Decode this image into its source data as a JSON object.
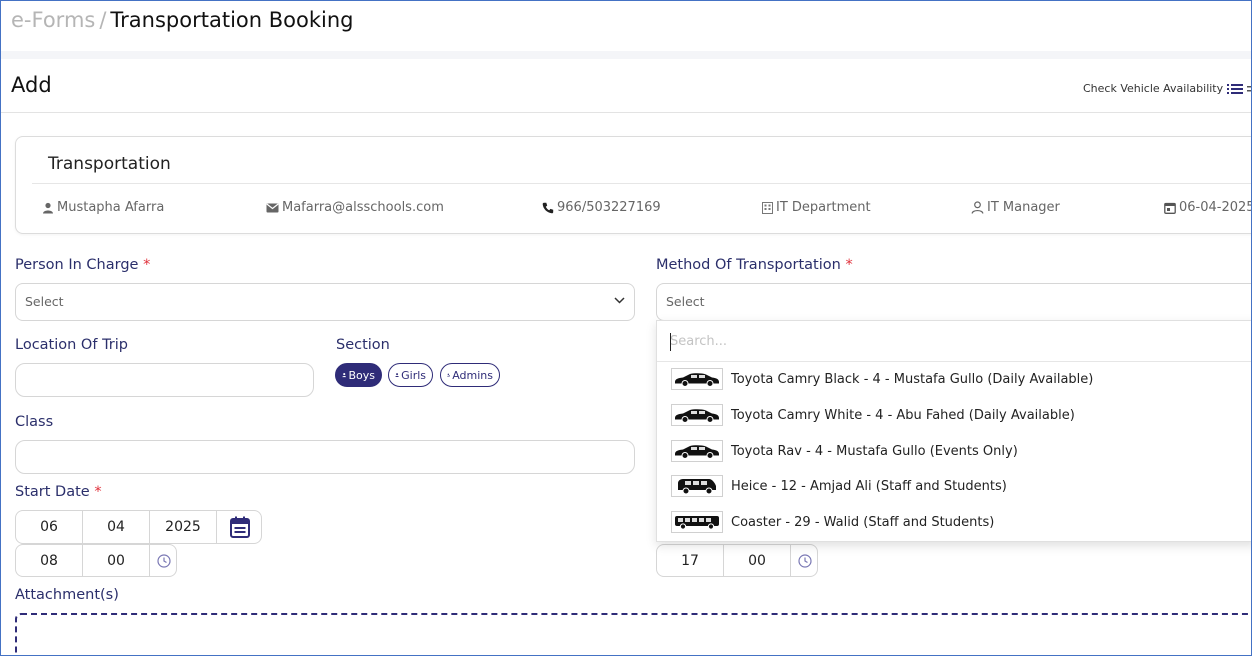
{
  "breadcrumb": {
    "root": "e-Forms",
    "separator": "/",
    "current": "Transportation Booking"
  },
  "page": {
    "title": "Add",
    "check_availability": "Check Vehicle Availability"
  },
  "card": {
    "title": "Transportation",
    "name": "Mustapha Afarra",
    "email": "Mafarra@alsschools.com",
    "phone": "966/503227169",
    "department": "IT Department",
    "role": "IT Manager",
    "date": "06-04-2025"
  },
  "form": {
    "person_in_charge": {
      "label": "Person In Charge",
      "required": "*",
      "placeholder": "Select"
    },
    "method": {
      "label": "Method Of Transportation",
      "required": "*",
      "placeholder": "Select"
    },
    "location": {
      "label": "Location Of Trip",
      "value": ""
    },
    "section": {
      "label": "Section",
      "options": [
        "Boys",
        "Girls",
        "Admins"
      ]
    },
    "class": {
      "label": "Class",
      "value": ""
    },
    "start_date": {
      "label": "Start Date",
      "required": "*",
      "day": "06",
      "month": "04",
      "year": "2025",
      "hour": "08",
      "minute": "00"
    },
    "end_time": {
      "hour": "17",
      "minute": "00"
    },
    "attachments": {
      "label": "Attachment(s)"
    }
  },
  "dropdown": {
    "search_placeholder": "Search...",
    "items": [
      {
        "label": "Toyota Camry Black - 4 - Mustafa Gullo (Daily Available)",
        "icon": "sedan-icon"
      },
      {
        "label": "Toyota Camry White - 4 - Abu Fahed (Daily Available)",
        "icon": "sedan-icon"
      },
      {
        "label": "Toyota Rav - 4 - Mustafa Gullo (Events Only)",
        "icon": "sedan-icon"
      },
      {
        "label": "Heice - 12 - Amjad Ali (Staff and Students)",
        "icon": "van-icon"
      },
      {
        "label": "Coaster - 29 - Walid (Staff and Students)",
        "icon": "bus-icon"
      }
    ]
  },
  "colors": {
    "accent": "#2f2c78",
    "label": "#2b2f6b",
    "required": "#e0303a",
    "frame": "#4472c4"
  }
}
